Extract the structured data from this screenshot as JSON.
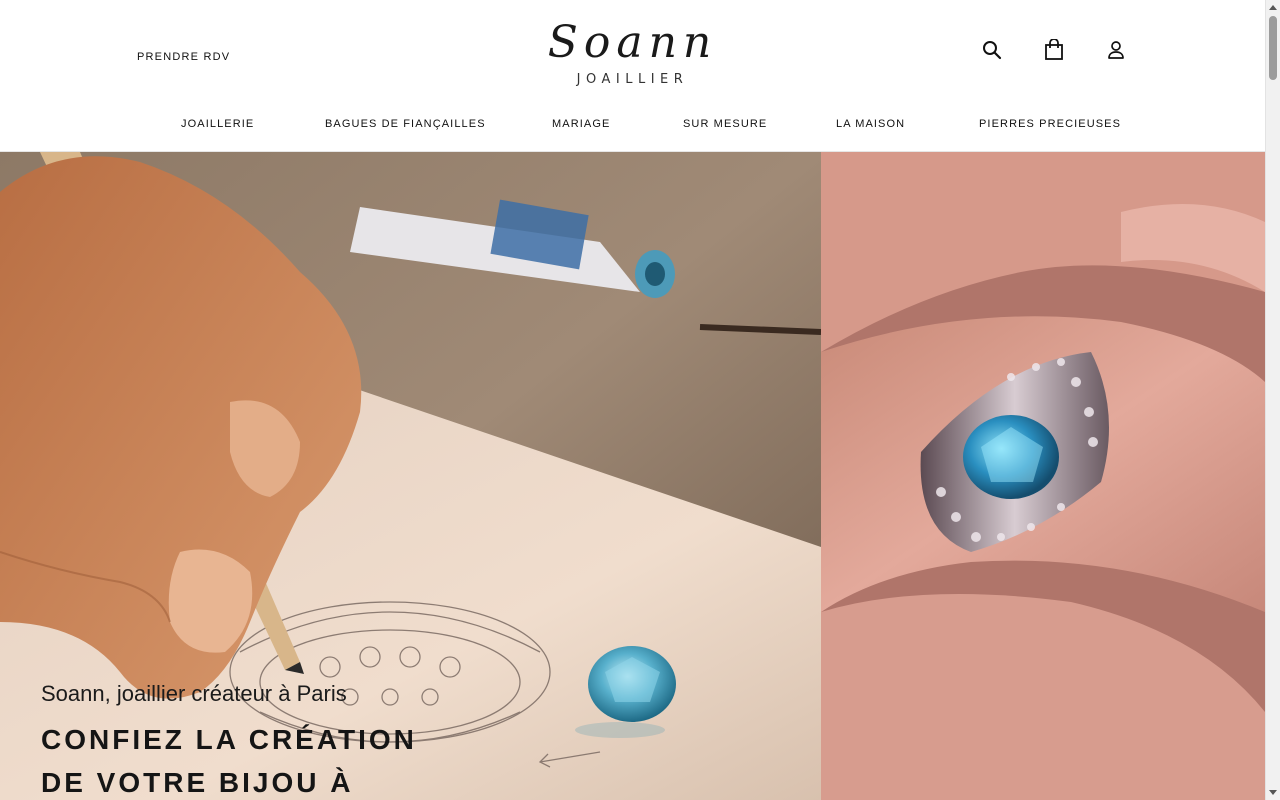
{
  "header": {
    "appointment_label": "PRENDRE RDV",
    "logo_script": "Soann",
    "logo_sub": "JOAILLIER",
    "icons": [
      "search-icon",
      "shopping-bag-icon",
      "user-icon"
    ]
  },
  "nav": {
    "items": [
      {
        "label": "JOAILLERIE"
      },
      {
        "label": "BAGUES DE FIANÇAILLES"
      },
      {
        "label": "MARIAGE"
      },
      {
        "label": "SUR MESURE"
      },
      {
        "label": "LA MAISON"
      },
      {
        "label": "PIERRES PRECIEUSES"
      }
    ]
  },
  "hero": {
    "subtitle": "Soann, joaillier créateur à Paris",
    "title_line1": "CONFIEZ LA CRÉATION",
    "title_line2": "DE VOTRE BIJOU À"
  },
  "colors": {
    "text": "#111111",
    "background": "#ffffff",
    "gem_blue": "#3f9fbf"
  }
}
